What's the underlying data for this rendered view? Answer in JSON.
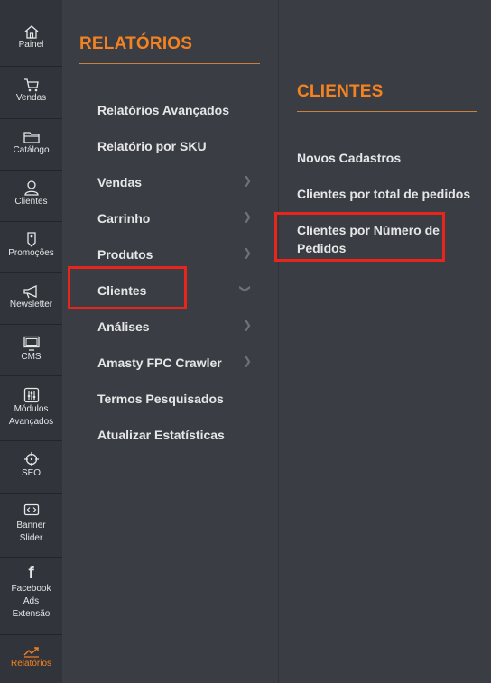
{
  "sidebar": {
    "items": [
      {
        "label": "Painel",
        "icon": "home-icon"
      },
      {
        "label": "Vendas",
        "icon": "cart-icon"
      },
      {
        "label": "Catálogo",
        "icon": "folder-icon"
      },
      {
        "label": "Clientes",
        "icon": "user-icon"
      },
      {
        "label": "Promoções",
        "icon": "tag-icon"
      },
      {
        "label": "Newsletter",
        "icon": "megaphone-icon"
      },
      {
        "label": "CMS",
        "icon": "monitor-icon"
      },
      {
        "label1": "Módulos",
        "label2": "Avançados",
        "icon": "sliders-icon"
      },
      {
        "label": "SEO",
        "icon": "crosshair-icon"
      },
      {
        "label1": "Banner",
        "label2": "Slider",
        "icon": "code-icon"
      },
      {
        "label1": "Facebook",
        "label2": "Ads",
        "label3": "Extensão",
        "icon": "facebook-icon"
      },
      {
        "label": "Relatórios",
        "icon": "chart-icon"
      }
    ],
    "active_color": "#f58220"
  },
  "reports": {
    "title": "RELATÓRIOS",
    "items": [
      {
        "label": "Relatórios Avançados"
      },
      {
        "label": "Relatório por SKU"
      },
      {
        "label": "Vendas"
      },
      {
        "label": "Carrinho"
      },
      {
        "label": "Produtos"
      },
      {
        "label": "Clientes"
      },
      {
        "label": "Análises"
      },
      {
        "label": "Amasty FPC Crawler"
      },
      {
        "label": "Termos Pesquisados"
      },
      {
        "label": "Atualizar Estatísticas"
      }
    ]
  },
  "clients": {
    "title": "CLIENTES",
    "items": [
      {
        "label": "Novos Cadastros"
      },
      {
        "label": "Clientes por total de pedidos"
      },
      {
        "label1": "Clientes por Número de",
        "label2": "Pedidos"
      }
    ]
  }
}
